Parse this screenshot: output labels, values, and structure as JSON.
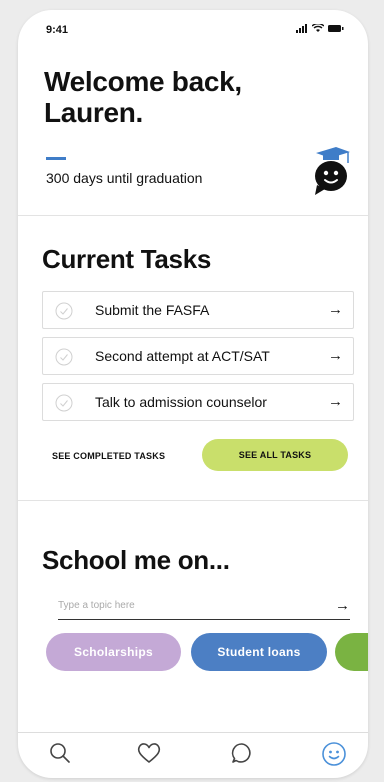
{
  "status": {
    "time": "9:41"
  },
  "header": {
    "greeting": "Welcome back, Lauren.",
    "countdown": "300 days until graduation"
  },
  "tasks": {
    "title": "Current Tasks",
    "items": [
      {
        "label": "Submit the FASFA",
        "arrow": "→"
      },
      {
        "label": "Second attempt at ACT/SAT",
        "arrow": "→"
      },
      {
        "label": "Talk to admission counselor",
        "arrow": "→"
      }
    ],
    "see_completed_label": "SEE COMPLETED TASKS",
    "see_all_label": "SEE ALL TASKS"
  },
  "school": {
    "title": "School me on...",
    "input_placeholder": "Type a topic here",
    "submit_arrow": "→",
    "chips": [
      {
        "label": "Scholarships",
        "color": "#c4a9d6"
      },
      {
        "label": "Student loans",
        "color": "#4c7fc4"
      },
      {
        "label": "",
        "color": "#7ab342"
      }
    ]
  },
  "tabbar": {
    "icons": [
      "search-icon",
      "heart-icon",
      "chat-icon",
      "profile-smiley-icon"
    ],
    "active_color": "#4a90d9"
  },
  "colors": {
    "accent_blue": "#3f7dc8",
    "lime": "#c9df6b"
  }
}
